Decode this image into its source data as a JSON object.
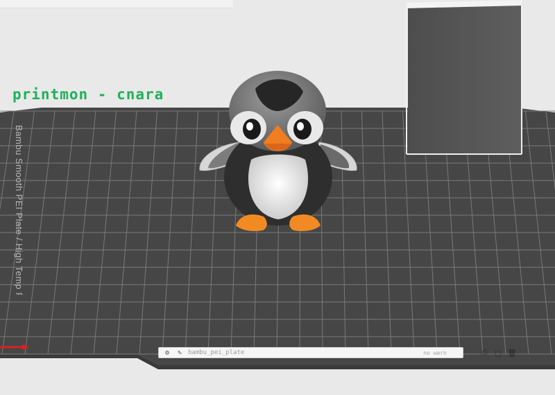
{
  "viewport": {
    "background": "#e9e9e9"
  },
  "build_plate": {
    "label": "printmon - cnara",
    "label_color": "#1fb15a",
    "side_label": "Bambu Smooth PEI Plate / High Temp Plate",
    "plate_color": "#464646",
    "grid_color": "#7a7a7a",
    "toolbar": {
      "text": "bambu_pei_plate",
      "status": "no warn"
    },
    "actions": {
      "arrange_icon": "print-icon",
      "select_icon": "square-select-icon",
      "delete_icon": "trash-icon"
    },
    "origin_axis_color": "#e02020"
  },
  "objects": [
    {
      "name": "Penguin",
      "colors": {
        "body": "#2e2e2e",
        "belly": "#e4e4e4",
        "beak": "#f07d1e",
        "feet": "#f28a24"
      }
    },
    {
      "name": "Prime tower",
      "color": "#555555"
    }
  ]
}
